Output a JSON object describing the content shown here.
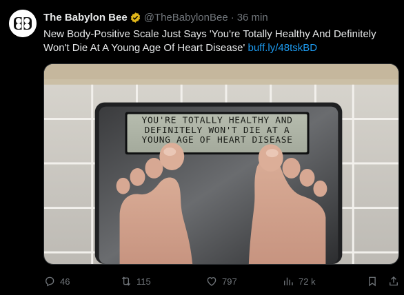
{
  "tweet": {
    "author_name": "The Babylon Bee",
    "handle": "@TheBabylonBee",
    "separator": "·",
    "time": "36 min",
    "text": "New Body-Positive Scale Just Says 'You're Totally Healthy And Definitely Won't Die At A Young Age Of Heart Disease'",
    "link": "buff.ly/48tskBD"
  },
  "image": {
    "scale_display_lines": [
      "YOU'RE TOTALLY HEALTHY AND",
      "DEFINITELY WON'T DIE AT A",
      "YOUNG AGE OF HEART DISEASE"
    ]
  },
  "actions": {
    "replies": "46",
    "retweets": "115",
    "likes": "797",
    "views": "72 k"
  },
  "colors": {
    "background": "#000000",
    "text": "#e7e9ea",
    "muted": "#71767b",
    "link": "#1d9bf0",
    "verified_gold": "#e2b719"
  },
  "icons": [
    "babylon-bee-logo",
    "verified-icon",
    "reply-icon",
    "retweet-icon",
    "like-icon",
    "views-icon",
    "bookmark-icon",
    "share-icon"
  ]
}
